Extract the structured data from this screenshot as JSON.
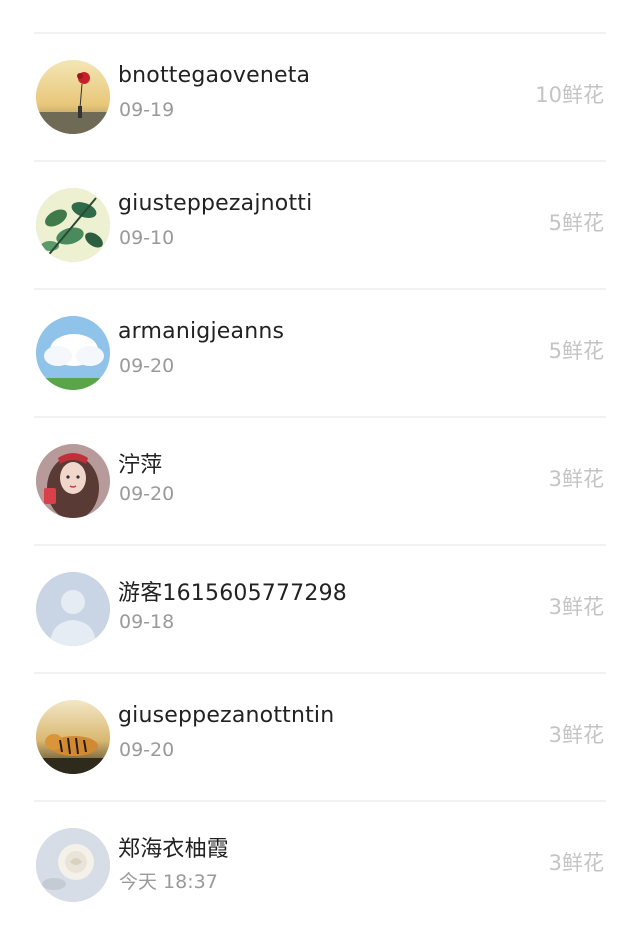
{
  "entries": [
    {
      "name": "bnottegaoveneta",
      "date": "09-19",
      "gift": "10鲜花",
      "avatar": "avatar-red-balloon"
    },
    {
      "name": "giusteppezajnotti",
      "date": "09-10",
      "gift": "5鲜花",
      "avatar": "avatar-green-leaves"
    },
    {
      "name": "armanigjeanns",
      "date": "09-20",
      "gift": "5鲜花",
      "avatar": "avatar-sky-clouds"
    },
    {
      "name": "泞萍",
      "date": "09-20",
      "gift": "3鲜花",
      "avatar": "avatar-girl-illustration"
    },
    {
      "name": "游客1615605777298",
      "date": "09-18",
      "gift": "3鲜花",
      "avatar": "avatar-default-person"
    },
    {
      "name": "giuseppezanottntin",
      "date": "09-20",
      "gift": "3鲜花",
      "avatar": "avatar-tiger"
    },
    {
      "name": "郑海衣柚霞",
      "date": "今天 18:37",
      "gift": "3鲜花",
      "avatar": "avatar-white-rose"
    }
  ],
  "colors": {
    "name_text": "#222222",
    "date_text": "#9a9a9a",
    "gift_text": "#c4c4c4",
    "divider": "#f2f2f2"
  }
}
